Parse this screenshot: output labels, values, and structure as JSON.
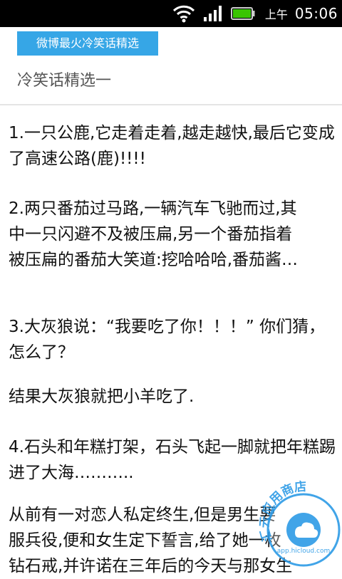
{
  "status_bar": {
    "ampm": "上午",
    "time": "05:06",
    "icons": [
      "wifi-icon",
      "signal-icon",
      "battery-icon"
    ],
    "battery_color": "#39c500"
  },
  "header": {
    "tab_label": "微博最火冷笑话精选",
    "tab_color": "#36a6e6",
    "section_title": "冷笑话精选一"
  },
  "jokes": {
    "j1": "1.一只公鹿,它走着走着,越走越快,最后它变成了高速公路(鹿)!!!!",
    "j2_line1": "2.两只番茄过马路,一辆汽车飞驰而过,其",
    "j2_line2": "中一只闪避不及被压扁,另一个番茄指着",
    "j2_line3": "被压扁的番茄大笑道:挖哈哈哈,番茄酱…",
    "j3": "3.大灰狼说：“我要吃了你！！！” 你们猜，怎么了？",
    "j3b": "结果大灰狼就把小羊吃了.",
    "j4": "4.石头和年糕打架，石头飞起一脚就把年糕踢进了大海………..",
    "j5_line1": "从前有一对恋人私定终生,但是男生要",
    "j5_line2": "服兵役,便和女生定下誓言,给了她一枚",
    "j5_line3": "钻石戒,并许诺在三年后的今天与那女生"
  },
  "watermark": {
    "arc_text": "汇云应用商店",
    "url": "app.hicloud.com",
    "color": "#2d9be6"
  }
}
